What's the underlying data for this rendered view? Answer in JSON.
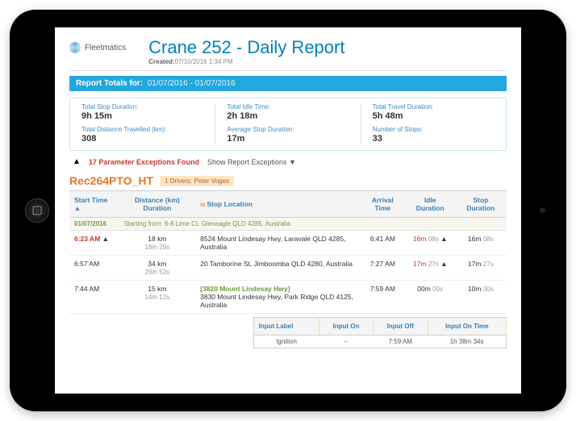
{
  "brand": "Fleetmatics",
  "report": {
    "title": "Crane 252 - Daily Report",
    "created_label": "Created:",
    "created_value": "07/10/2016 1:34 PM",
    "totals_label": "Report Totals for:",
    "range": "01/07/2016 - 01/07/2016"
  },
  "stats": {
    "col1": {
      "l1": "Total Stop Duration:",
      "v1": "9h 15m",
      "l2": "Total Distance Travelled (km):",
      "v2": "308"
    },
    "col2": {
      "l1": "Total Idle Time:",
      "v1": "2h 18m",
      "l2": "Average Stop Duration:",
      "v2": "17m"
    },
    "col3": {
      "l1": "Total Travel Duration:",
      "v1": "5h 48m",
      "l2": "Number of Stops:",
      "v2": "33"
    }
  },
  "exceptions": {
    "count_text": "17 Parameter Exceptions Found",
    "show_label": "Show Report Exceptions ▼"
  },
  "vehicle": "Rec264PTO_HT",
  "drivers_badge": "1 Drivers: Peter Voges",
  "columns": {
    "start": "Start Time",
    "dist": "Distance (km) Duration",
    "stop": "Stop Location",
    "arr": "Arrival Time",
    "idle": "Idle Duration",
    "sdur": "Stop Duration"
  },
  "daterow": {
    "date": "01/07/2016",
    "from": "Starting from: 6-8 Lime Ct, Gleneagle QLD 4285, Australia"
  },
  "rows": [
    {
      "start": "6:23 AM",
      "start_red": true,
      "start_warn": true,
      "dist": "18 km",
      "dur": "18m 29s",
      "loc": "8524 Mount Lindesay Hwy, Laravale QLD 4285, Australia",
      "loc_link": false,
      "arr": "6:41 AM",
      "idle": "16m",
      "idle_sub": "08s",
      "idle_red": true,
      "idle_warn": true,
      "stop": "16m",
      "stop_sub": "08s"
    },
    {
      "start": "6:57 AM",
      "start_red": false,
      "start_warn": false,
      "dist": "34 km",
      "dur": "29m 52s",
      "loc": "20 Tamborine St, Jimboomba QLD 4280, Australia",
      "loc_link": false,
      "arr": "7:27 AM",
      "idle": "17m",
      "idle_sub": "27s",
      "idle_red": true,
      "idle_warn": true,
      "stop": "17m",
      "stop_sub": "27s"
    },
    {
      "start": "7:44 AM",
      "start_red": false,
      "start_warn": false,
      "dist": "15 km",
      "dur": "14m 12s",
      "loc_head": "[3820 Mount Lindesay Hwy]",
      "loc": "3830 Mount Lindesay Hwy, Park Ridge QLD 4125, Australia",
      "loc_link": true,
      "arr": "7:59 AM",
      "idle": "00m",
      "idle_sub": "00s",
      "idle_red": false,
      "idle_warn": false,
      "stop": "10m",
      "stop_sub": "30s"
    }
  ],
  "input_panel": {
    "h_label": "Input Label",
    "h_on": "Input On",
    "h_off": "Input Off",
    "h_time": "Input On Time",
    "r_label": "Ignition",
    "r_on": "--",
    "r_off": "7:59 AM",
    "r_time": "1h 38m 34s"
  }
}
